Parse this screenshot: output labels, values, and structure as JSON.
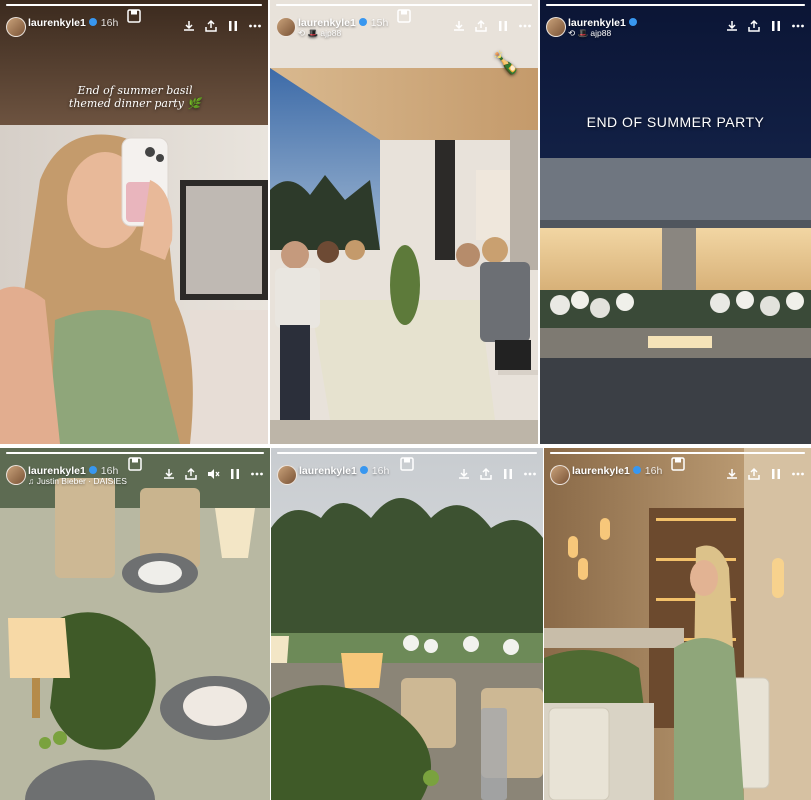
{
  "stories": [
    {
      "username": "laurenkyle1",
      "time": "16h",
      "subline": "",
      "caption": "End of summer basil themed dinner party 🌿",
      "icons": [
        "save-icon",
        "download-icon",
        "share-story-icon",
        "pause-icon",
        "more-icon"
      ]
    },
    {
      "username": "laurenkyle1",
      "time": "15h",
      "subline": "⟲ 🎩 ajp88",
      "caption": "🍾",
      "icons": [
        "save-icon",
        "download-icon",
        "share-story-icon",
        "pause-icon",
        "more-icon"
      ]
    },
    {
      "username": "laurenkyle1",
      "time": "",
      "subline": "⟲ 🎩 ajp88",
      "caption": "END OF SUMMER PARTY",
      "icons": [
        "save-icon",
        "download-icon",
        "share-story-icon",
        "pause-icon",
        "more-icon"
      ]
    },
    {
      "username": "laurenkyle1",
      "time": "16h",
      "subline": "♫ Justin Bieber · DAISIES",
      "caption": "",
      "icons": [
        "save-icon",
        "download-icon",
        "share-story-icon",
        "mute-icon",
        "pause-icon",
        "more-icon"
      ]
    },
    {
      "username": "laurenkyle1",
      "time": "16h",
      "subline": "",
      "caption": "",
      "icons": [
        "save-icon",
        "download-icon",
        "share-story-icon",
        "pause-icon",
        "more-icon"
      ]
    },
    {
      "username": "laurenkyle1",
      "time": "16h",
      "subline": "",
      "caption": "",
      "icons": [
        "save-icon",
        "download-icon",
        "share-story-icon",
        "pause-icon",
        "more-icon"
      ]
    }
  ],
  "colors": {
    "verified": "#3897f0",
    "dress": "#8fa67a",
    "sky_dusk": "#5b84b8",
    "night": "#0f1b3d"
  }
}
